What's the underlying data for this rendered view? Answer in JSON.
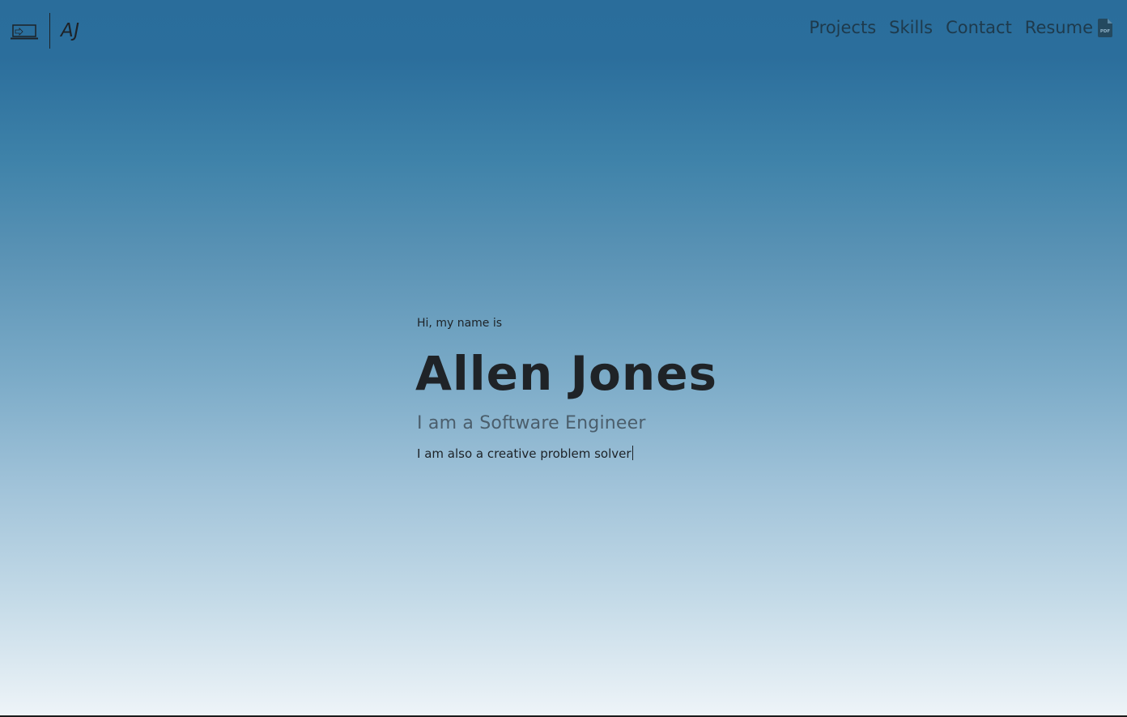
{
  "nav": {
    "logo_icon": "laptop-icon",
    "initials": "AJ",
    "links": [
      {
        "label": "Projects"
      },
      {
        "label": "Skills"
      },
      {
        "label": "Contact"
      },
      {
        "label": "Resume",
        "icon": "pdf-file-icon"
      }
    ]
  },
  "hero": {
    "greeting": "Hi, my name is",
    "name": "Allen Jones",
    "role": "I am a Software Engineer",
    "tagline": "I am also a creative problem solver"
  },
  "colors": {
    "background_top": "#2a6d9b",
    "background_bottom": "#eef4f8",
    "text_primary": "#1d2227",
    "nav_text": "#1e3a4c",
    "role_text": "#4b5e6c"
  }
}
